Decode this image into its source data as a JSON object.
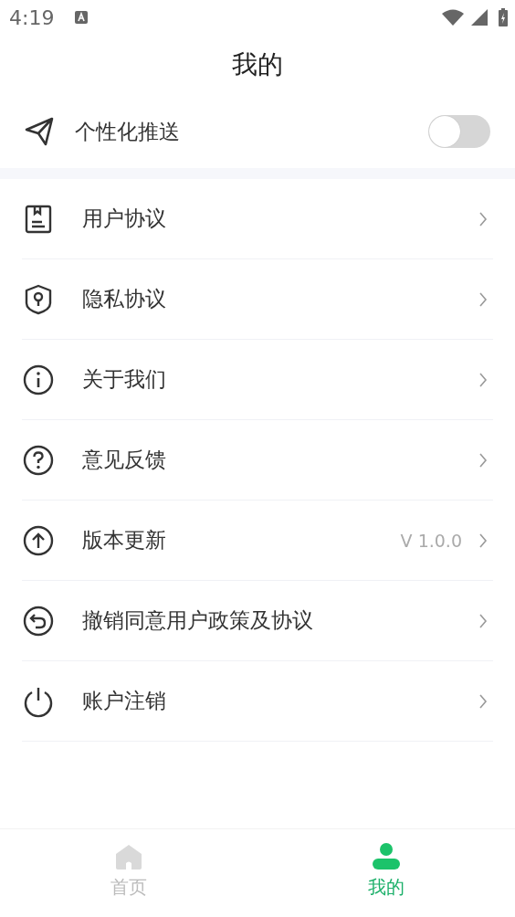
{
  "status_bar": {
    "time": "4:19"
  },
  "title": "我的",
  "push_setting": {
    "label": "个性化推送",
    "on": false
  },
  "menu": [
    {
      "kind": "document",
      "label": "用户协议"
    },
    {
      "kind": "shield",
      "label": "隐私协议"
    },
    {
      "kind": "info",
      "label": "关于我们"
    },
    {
      "kind": "help",
      "label": "意见反馈"
    },
    {
      "kind": "upload",
      "label": "版本更新",
      "value": "V 1.0.0"
    },
    {
      "kind": "undo",
      "label": "撤销同意用户政策及协议"
    },
    {
      "kind": "power",
      "label": "账户注销"
    }
  ],
  "tabs": [
    {
      "kind": "home",
      "label": "首页",
      "selected": false
    },
    {
      "kind": "user",
      "label": "我的",
      "selected": true
    }
  ]
}
